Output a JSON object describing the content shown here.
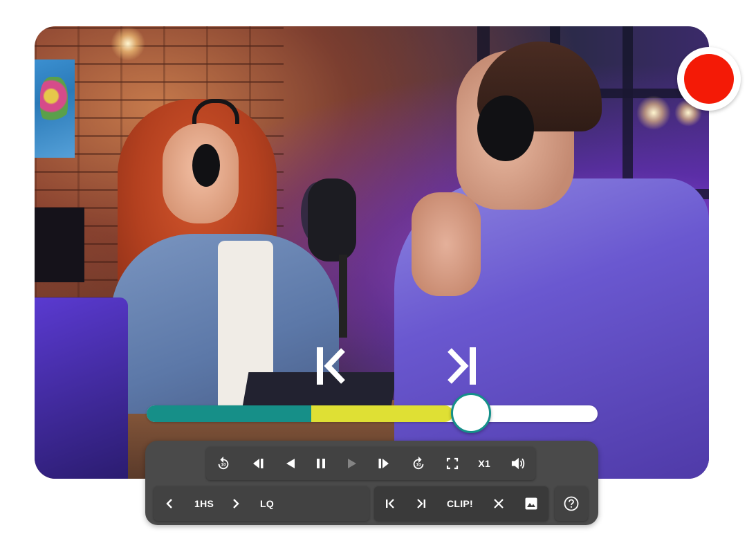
{
  "player": {
    "accent_played": "#168f88",
    "accent_buffered": "#dfe034",
    "record_color": "#f41a06",
    "progress": {
      "played_fraction": 0.365,
      "buffered_fraction": 0.68,
      "thumb_fraction": 0.72
    }
  },
  "overlay": {
    "icons": [
      "jump-to-start-marker-icon",
      "jump-to-end-marker-icon",
      "record-indicator-icon"
    ]
  },
  "controls": {
    "top_row": {
      "icons": [
        "rewind-10-icon",
        "prev-frame-icon",
        "step-back-icon",
        "pause-icon",
        "play-icon",
        "next-frame-icon",
        "forward-10-icon",
        "fullscreen-icon",
        "volume-icon"
      ],
      "rewind_seconds": "10",
      "forward_seconds": "10",
      "speed_label": "X1"
    },
    "bottom_left": {
      "interval_label": "1HS",
      "quality_label": "LQ",
      "icons": [
        "chevron-left-icon",
        "chevron-right-icon"
      ]
    },
    "bottom_right": {
      "clip_label": "CLIP!",
      "icons": [
        "clip-start-icon",
        "clip-end-icon",
        "close-icon",
        "image-icon"
      ]
    },
    "help": {
      "icon": "help-icon"
    }
  }
}
